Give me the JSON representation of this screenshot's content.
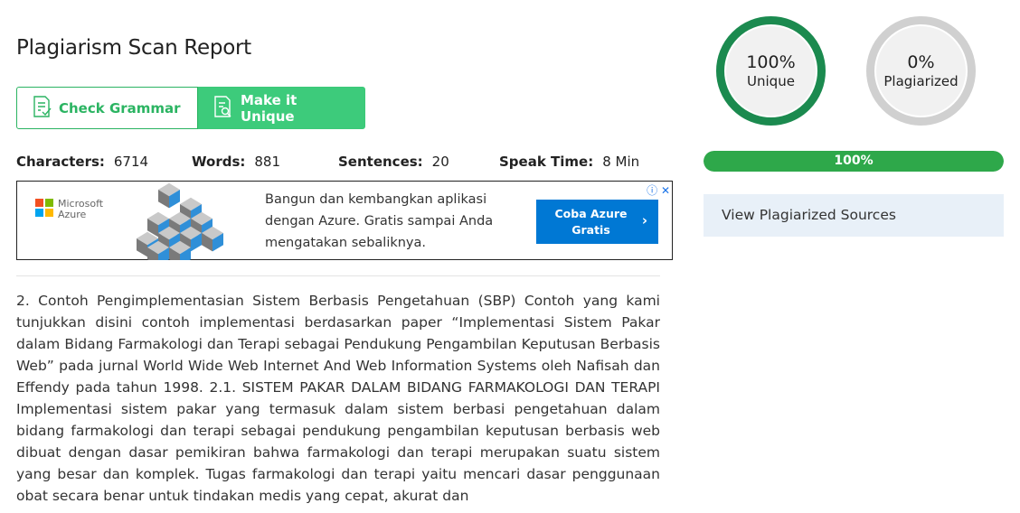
{
  "report": {
    "title": "Plagiarism Scan Report",
    "check_grammar_label": "Check Grammar",
    "make_unique_label": "Make it Unique"
  },
  "stats": {
    "characters_label": "Characters:",
    "characters_value": "6714",
    "words_label": "Words:",
    "words_value": "881",
    "sentences_label": "Sentences:",
    "sentences_value": "20",
    "speak_time_label": "Speak Time:",
    "speak_time_value": "8 Min"
  },
  "ad": {
    "brand_line1": "Microsoft",
    "brand_line2": "Azure",
    "text": "Bangun dan kembangkan aplikasi dengan Azure. Gratis sampai Anda mengatakan sebaliknya.",
    "cta_line1": "Coba Azure",
    "cta_line2": "Gratis",
    "colors": {
      "red": "#f25022",
      "green": "#7fba00",
      "blue": "#00a4ef",
      "yellow": "#ffb900",
      "cta": "#0078d4"
    }
  },
  "content": {
    "paragraph": "2. Contoh Pengimplementasian Sistem Berbasis Pengetahuan (SBP) Contoh yang kami tunjukkan disini contoh implementasi berdasarkan paper “Implementasi Sistem Pakar dalam Bidang Farmakologi dan Terapi sebagai Pendukung Pengambilan Keputusan Berbasis Web” pada jurnal World Wide Web Internet And Web Information Systems oleh Nafisah dan Effendy pada tahun 1998. 2.1. SISTEM PAKAR DALAM BIDANG FARMAKOLOGI DAN TERAPI Implementasi sistem pakar yang termasuk dalam sistem berbasi pengetahuan dalam bidang farmakologi dan terapi sebagai pendukung pengambilan keputusan berbasis web dibuat dengan dasar pemikiran bahwa farmakologi dan terapi merupakan suatu sistem yang besar dan komplek. Tugas farmakologi dan terapi yaitu mencari dasar penggunaan obat secara benar untuk tindakan medis yang cepat, akurat dan"
  },
  "results": {
    "unique_pct": "100%",
    "unique_label": "Unique",
    "plagiarized_pct": "0%",
    "plagiarized_label": "Plagiarized",
    "progress_label": "100%",
    "progress_value": 1.0,
    "view_sources_label": "View Plagiarized Sources",
    "colors": {
      "unique_ring": "#1b8a4f",
      "plag_ring": "#d0d0d0",
      "progress": "#2ea84a"
    }
  }
}
